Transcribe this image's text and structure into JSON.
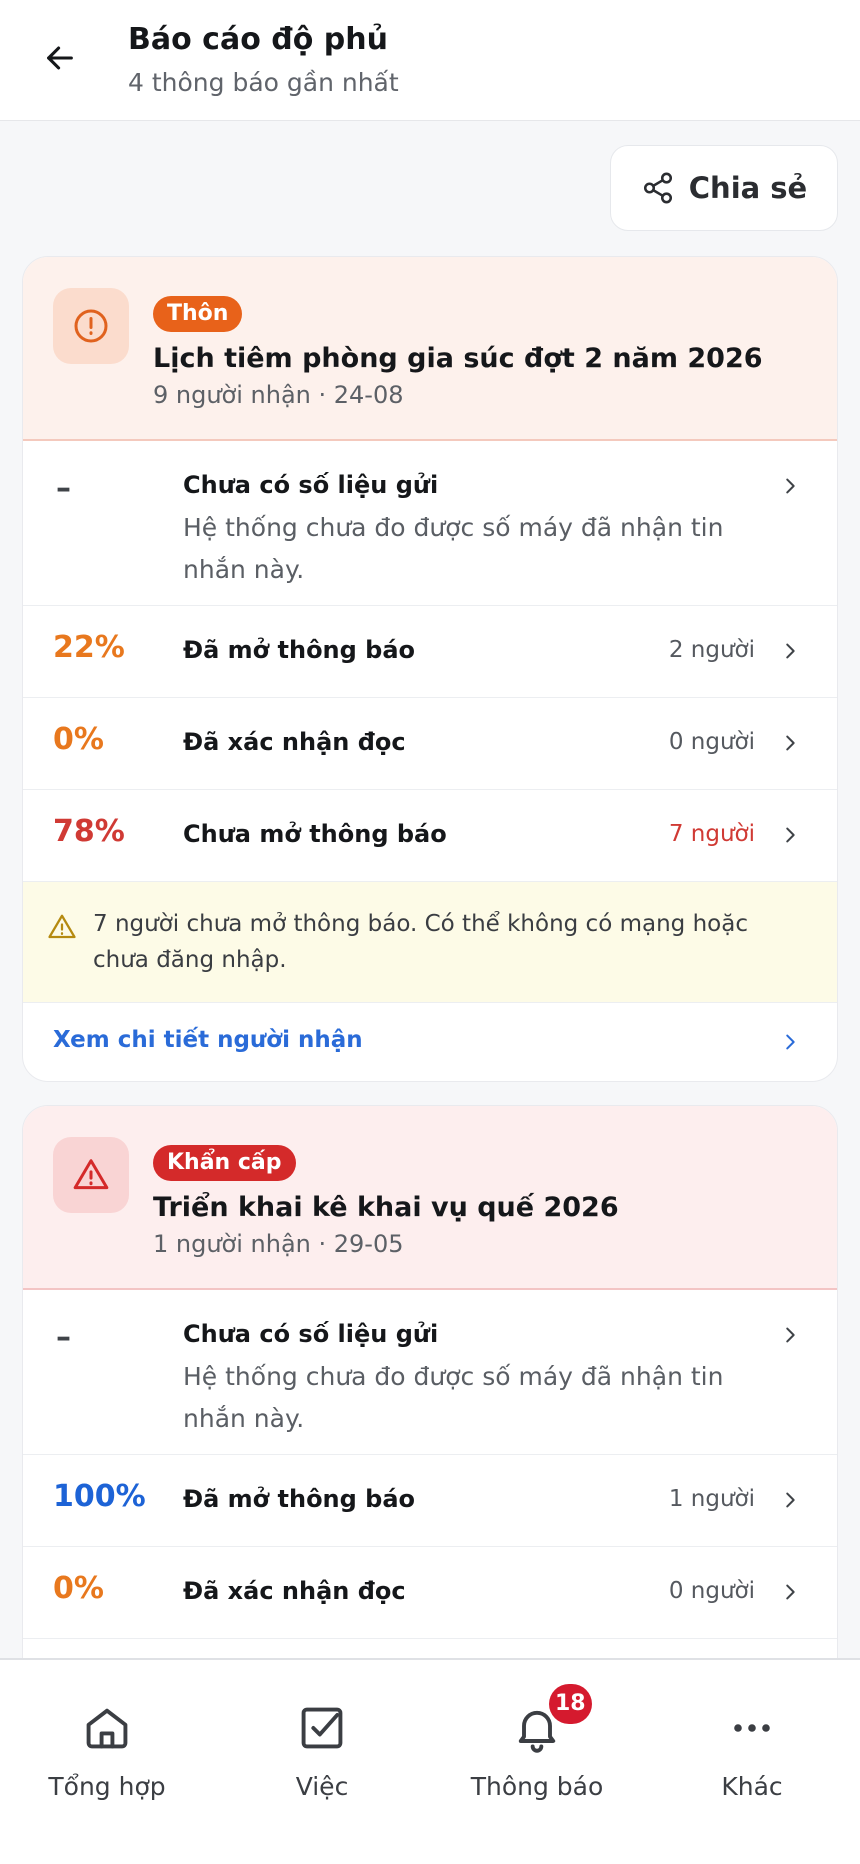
{
  "header": {
    "title": "Báo cáo độ phủ",
    "subtitle": "4 thông báo gần nhất"
  },
  "share_label": "Chia sẻ",
  "cards": [
    {
      "tag": "Thôn",
      "title": "Lịch tiêm phòng gia súc đợt 2 năm 2026",
      "meta": "9 người nhận · 24-08",
      "no_data": {
        "symbol": "–",
        "label": "Chưa có số liệu gửi",
        "desc": "Hệ thống chưa đo được số máy đã nhận tin nhắn này."
      },
      "stats": [
        {
          "pct": "22%",
          "label": "Đã mở thông báo",
          "count": "2 người"
        },
        {
          "pct": "0%",
          "label": "Đã xác nhận đọc",
          "count": "0 người"
        },
        {
          "pct": "78%",
          "label": "Chưa mở thông báo",
          "count": "7 người"
        }
      ],
      "warning": "7 người chưa mở thông báo. Có thể không có mạng hoặc chưa đăng nhập.",
      "detail_link": "Xem chi tiết người nhận"
    },
    {
      "tag": "Khẩn cấp",
      "title": "Triển khai kê khai vụ quế 2026",
      "meta": "1 người nhận · 29-05",
      "no_data": {
        "symbol": "–",
        "label": "Chưa có số liệu gửi",
        "desc": "Hệ thống chưa đo được số máy đã nhận tin nhắn này."
      },
      "stats": [
        {
          "pct": "100%",
          "label": "Đã mở thông báo",
          "count": "1 người"
        },
        {
          "pct": "0%",
          "label": "Đã xác nhận đọc",
          "count": "0 người"
        }
      ]
    }
  ],
  "nav": {
    "items": [
      {
        "label": "Tổng hợp",
        "icon": "home-icon"
      },
      {
        "label": "Việc",
        "icon": "checkbox-icon"
      },
      {
        "label": "Thông báo",
        "icon": "bell-icon",
        "badge": "18"
      },
      {
        "label": "Khác",
        "icon": "more-icon"
      }
    ]
  },
  "colors": {
    "orange": "#e8781e",
    "red": "#d03a34",
    "blue": "#1d63d6",
    "tag_thon": "#e8621a",
    "tag_urgent": "#d42a2a",
    "badge": "#d51a2e"
  }
}
